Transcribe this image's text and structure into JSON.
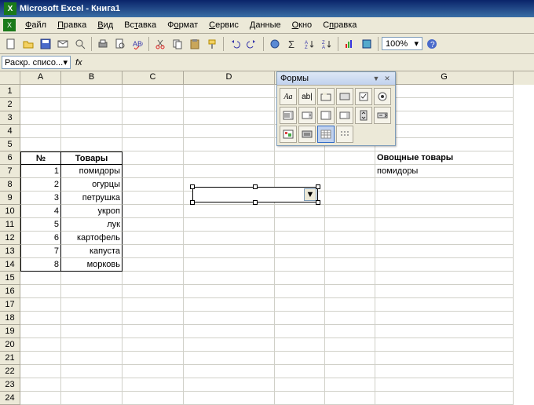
{
  "window": {
    "title": "Microsoft Excel - Книга1"
  },
  "menu": [
    "Файл",
    "Правка",
    "Вид",
    "Вставка",
    "Формат",
    "Сервис",
    "Данные",
    "Окно",
    "Справка"
  ],
  "menu_underline_idx": [
    0,
    0,
    0,
    2,
    1,
    0,
    0,
    0,
    1
  ],
  "toolbar": {
    "zoom": "100%"
  },
  "namebox": "Раскр. списо...",
  "columns": [
    "A",
    "B",
    "C",
    "D",
    "E",
    "F",
    "G"
  ],
  "row_count": 24,
  "table": {
    "headers": {
      "no": "№",
      "goods": "Товары"
    },
    "rows": [
      {
        "n": "1",
        "t": "помидоры"
      },
      {
        "n": "2",
        "t": "огурцы"
      },
      {
        "n": "3",
        "t": "петрушка"
      },
      {
        "n": "4",
        "t": "укроп"
      },
      {
        "n": "5",
        "t": "лук"
      },
      {
        "n": "6",
        "t": "картофель"
      },
      {
        "n": "7",
        "t": "капуста"
      },
      {
        "n": "8",
        "t": "морковь"
      }
    ]
  },
  "side": {
    "header": "Овощные товары",
    "value": "помидоры"
  },
  "forms": {
    "title": "Формы",
    "icons": [
      "Aa",
      "ab|",
      "group",
      "btn",
      "chk",
      "rad",
      "list",
      "combo",
      "scrb",
      "scrh",
      "spin",
      "lbl",
      "img",
      "tgl",
      "grid",
      "dots"
    ]
  },
  "chart_data": {
    "type": "table",
    "title": "Товары",
    "columns": [
      "№",
      "Товары"
    ],
    "rows": [
      [
        1,
        "помидоры"
      ],
      [
        2,
        "огурцы"
      ],
      [
        3,
        "петрушка"
      ],
      [
        4,
        "укроп"
      ],
      [
        5,
        "лук"
      ],
      [
        6,
        "картофель"
      ],
      [
        7,
        "капуста"
      ],
      [
        8,
        "морковь"
      ]
    ]
  }
}
